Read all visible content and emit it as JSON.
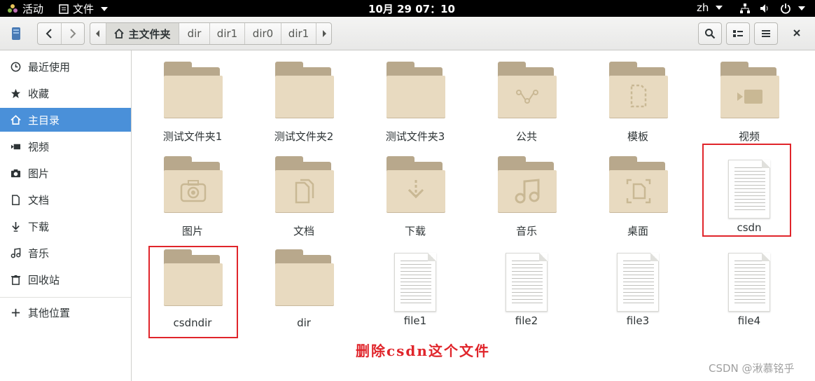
{
  "topbar": {
    "activities": "活动",
    "app_menu": "文件",
    "clock": "10月 29  07：10",
    "input_method": "zh"
  },
  "headerbar": {
    "path": [
      "主文件夹",
      "dir",
      "dir1",
      "dir0",
      "dir1"
    ]
  },
  "sidebar": {
    "items": [
      {
        "label": "最近使用",
        "icon": "clock-icon"
      },
      {
        "label": "收藏",
        "icon": "star-icon"
      },
      {
        "label": "主目录",
        "icon": "home-icon"
      },
      {
        "label": "视频",
        "icon": "video-icon"
      },
      {
        "label": "图片",
        "icon": "camera-icon"
      },
      {
        "label": "文档",
        "icon": "document-icon"
      },
      {
        "label": "下载",
        "icon": "download-icon"
      },
      {
        "label": "音乐",
        "icon": "music-icon"
      },
      {
        "label": "回收站",
        "icon": "trash-icon"
      }
    ],
    "other": "其他位置"
  },
  "files": [
    {
      "name": "测试文件夹1",
      "type": "folder",
      "emblem": ""
    },
    {
      "name": "测试文件夹2",
      "type": "folder",
      "emblem": ""
    },
    {
      "name": "测试文件夹3",
      "type": "folder",
      "emblem": ""
    },
    {
      "name": "公共",
      "type": "folder",
      "emblem": "share"
    },
    {
      "name": "模板",
      "type": "folder",
      "emblem": "template"
    },
    {
      "name": "视频",
      "type": "folder",
      "emblem": "video"
    },
    {
      "name": "图片",
      "type": "folder",
      "emblem": "camera"
    },
    {
      "name": "文档",
      "type": "folder",
      "emblem": "document"
    },
    {
      "name": "下载",
      "type": "folder",
      "emblem": "download"
    },
    {
      "name": "音乐",
      "type": "folder",
      "emblem": "music"
    },
    {
      "name": "桌面",
      "type": "folder",
      "emblem": "desktop"
    },
    {
      "name": "csdn",
      "type": "file",
      "emblem": ""
    },
    {
      "name": "csdndir",
      "type": "folder",
      "emblem": ""
    },
    {
      "name": "dir",
      "type": "folder",
      "emblem": ""
    },
    {
      "name": "file1",
      "type": "file",
      "emblem": ""
    },
    {
      "name": "file2",
      "type": "file",
      "emblem": ""
    },
    {
      "name": "file3",
      "type": "file",
      "emblem": ""
    },
    {
      "name": "file4",
      "type": "file",
      "emblem": ""
    }
  ],
  "annotation": "删除csdn这个文件",
  "watermark": "CSDN @湫慕铭乎",
  "colors": {
    "accent": "#4a90d9",
    "annotation": "#e0252b",
    "folder_front": "#e8dac0",
    "folder_back": "#b8a88c"
  }
}
